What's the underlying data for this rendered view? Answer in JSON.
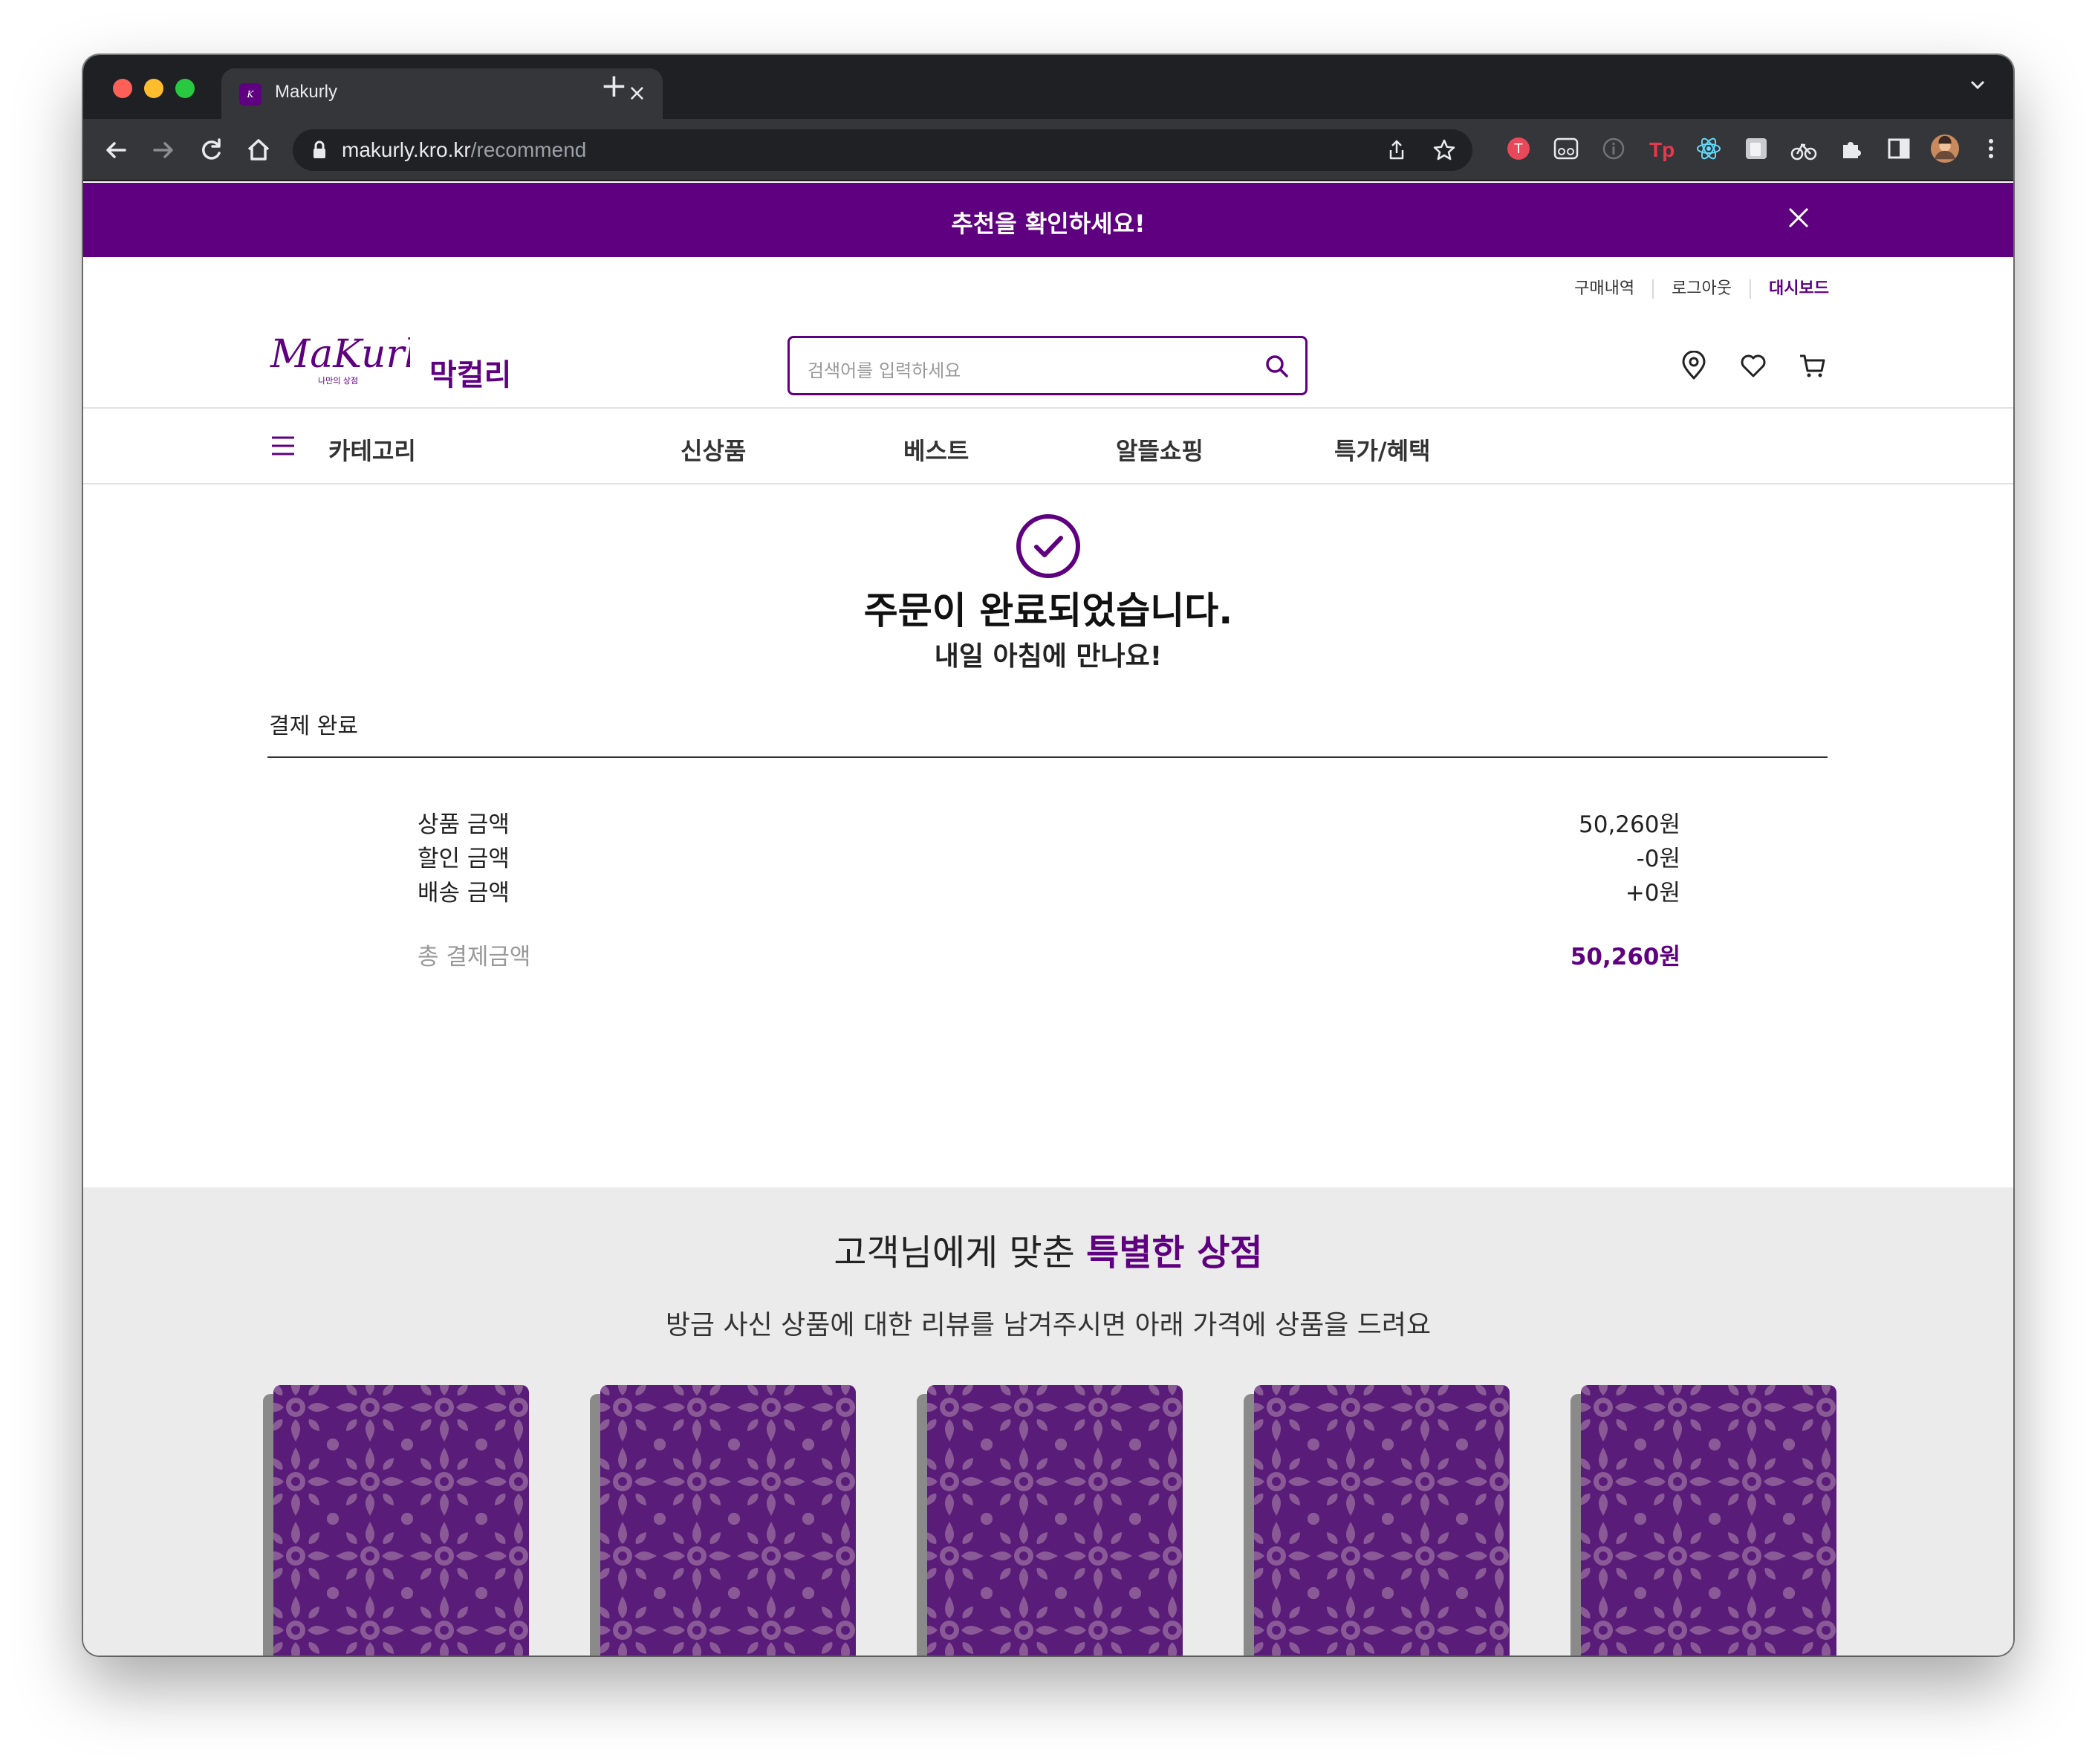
{
  "browser": {
    "tab_title": "Makurly",
    "url_host": "makurly.kro.kr",
    "url_path": "/recommend"
  },
  "promo": {
    "text": "추천을 확인하세요!"
  },
  "user_menu": {
    "orders": "구매내역",
    "logout": "로그아웃",
    "dashboard": "대시보드"
  },
  "header": {
    "logo_text": "MaKurly",
    "logo_tagline": "나만의 상점",
    "brand": "막컬리",
    "search_placeholder": "검색어를 입력하세요"
  },
  "gnb": [
    "카테고리",
    "신상품",
    "베스트",
    "알뜰쇼핑",
    "특가/혜택"
  ],
  "order": {
    "title": "주문이 완료되었습니다.",
    "subtitle": "내일 아침에 만나요!"
  },
  "payment": {
    "section_title": "결제 완료",
    "rows": [
      {
        "label": "상품 금액",
        "value": "50,260원"
      },
      {
        "label": "할인 금액",
        "value": "-0원"
      },
      {
        "label": "배송 금액",
        "value": "+0원"
      }
    ],
    "total_label": "총 결제금액",
    "total_value": "50,260원"
  },
  "recommend": {
    "title_prefix": "고객님에게 맞춘 ",
    "title_highlight": "특별한 상점",
    "subtitle": "방금 사신 상품에 대한 리뷰를 남겨주시면 아래 가격에 상품을 드려요"
  },
  "colors": {
    "brand": "#5f0080",
    "card": "#5a1c79",
    "card_pattern": "#8a5a96",
    "page_gray": "#ebebeb"
  }
}
